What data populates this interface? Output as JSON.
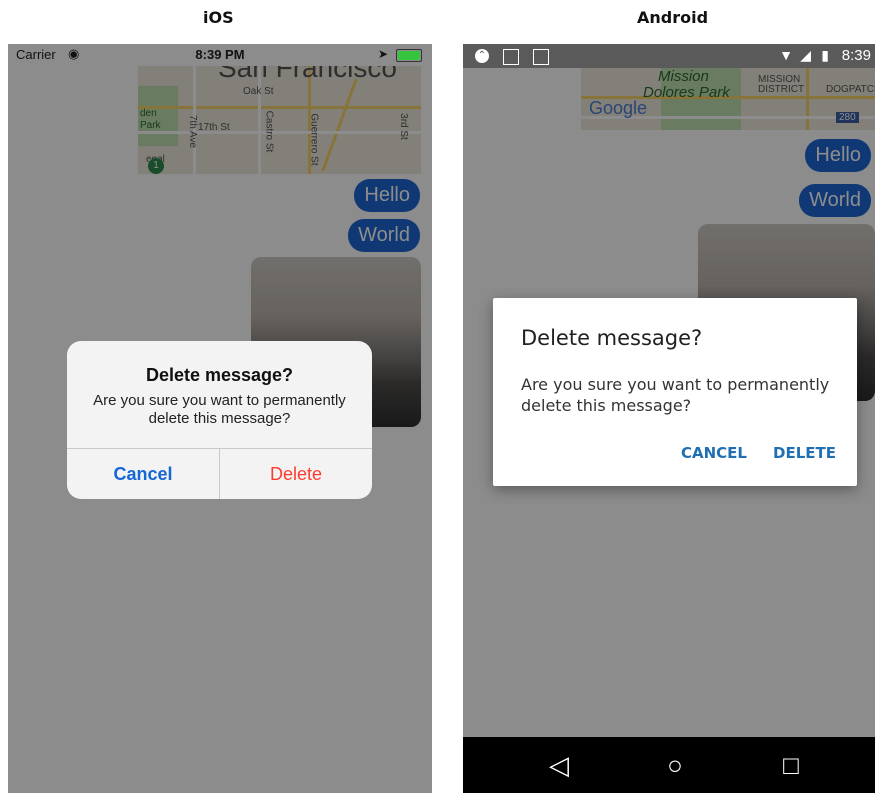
{
  "headers": {
    "ios": "iOS",
    "android": "Android"
  },
  "ios": {
    "status": {
      "carrier": "Carrier",
      "time": "8:39 PM"
    },
    "map": {
      "city": "San Francisco",
      "labels": [
        "Oak St",
        "17th St",
        "7th Ave",
        "Castro St",
        "Guerrero St",
        "3rd St",
        "den",
        "Park",
        "egal",
        "1"
      ]
    },
    "messages": [
      "Hello",
      "World"
    ],
    "alert": {
      "title": "Delete message?",
      "message": "Are you sure you want to permanently delete this message?",
      "cancel": "Cancel",
      "delete": "Delete"
    }
  },
  "android": {
    "status": {
      "time": "8:39"
    },
    "map": {
      "labels": [
        "Mission",
        "Dolores Park",
        "MISSION",
        "DISTRICT",
        "DOGPATCH",
        "280"
      ],
      "brand": "Google"
    },
    "messages": [
      "Hello",
      "World"
    ],
    "alert": {
      "title": "Delete message?",
      "message": "Are you sure you want to permanently delete this message?",
      "cancel": "CANCEL",
      "delete": "DELETE"
    }
  },
  "colors": {
    "bubble": "#1c67d6",
    "ios_delete": "#ff3b30",
    "ios_cancel": "#1467d6",
    "android_button": "#1f6fb2"
  }
}
